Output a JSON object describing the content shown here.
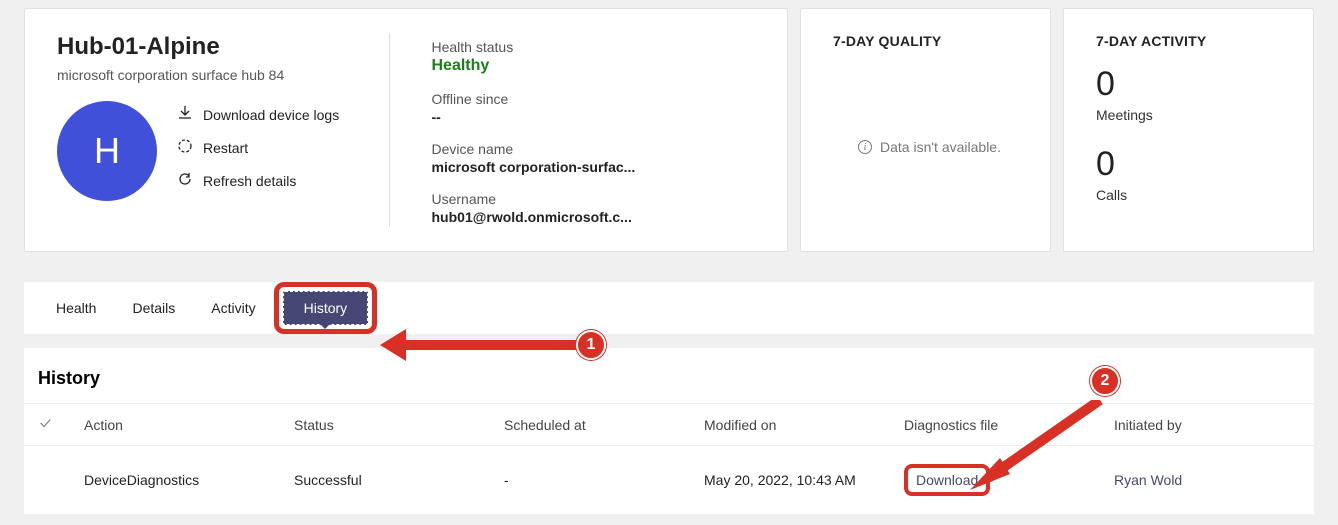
{
  "device": {
    "name": "Hub-01-Alpine",
    "subtitle": "microsoft corporation surface hub 84",
    "avatar_letter": "H"
  },
  "actions": {
    "download_logs": "Download device logs",
    "restart": "Restart",
    "refresh": "Refresh details"
  },
  "details": {
    "health_label": "Health status",
    "health_value": "Healthy",
    "offline_label": "Offline since",
    "offline_value": "--",
    "devname_label": "Device name",
    "devname_value": "microsoft corporation-surfac...",
    "username_label": "Username",
    "username_value": "hub01@rwold.onmicrosoft.c..."
  },
  "quality": {
    "title": "7-DAY QUALITY",
    "empty": "Data isn't available."
  },
  "activity": {
    "title": "7-DAY ACTIVITY",
    "meetings_count": "0",
    "meetings_label": "Meetings",
    "calls_count": "0",
    "calls_label": "Calls"
  },
  "tabs": {
    "health": "Health",
    "details": "Details",
    "activity": "Activity",
    "history": "History"
  },
  "history": {
    "title": "History",
    "cols": {
      "action": "Action",
      "status": "Status",
      "scheduled": "Scheduled at",
      "modified": "Modified on",
      "diag": "Diagnostics file",
      "initiated": "Initiated by"
    },
    "row": {
      "action": "DeviceDiagnostics",
      "status": "Successful",
      "scheduled": "-",
      "modified": "May 20, 2022, 10:43 AM",
      "diag": "Download",
      "initiated": "Ryan Wold"
    }
  },
  "annotations": {
    "one": "1",
    "two": "2"
  }
}
